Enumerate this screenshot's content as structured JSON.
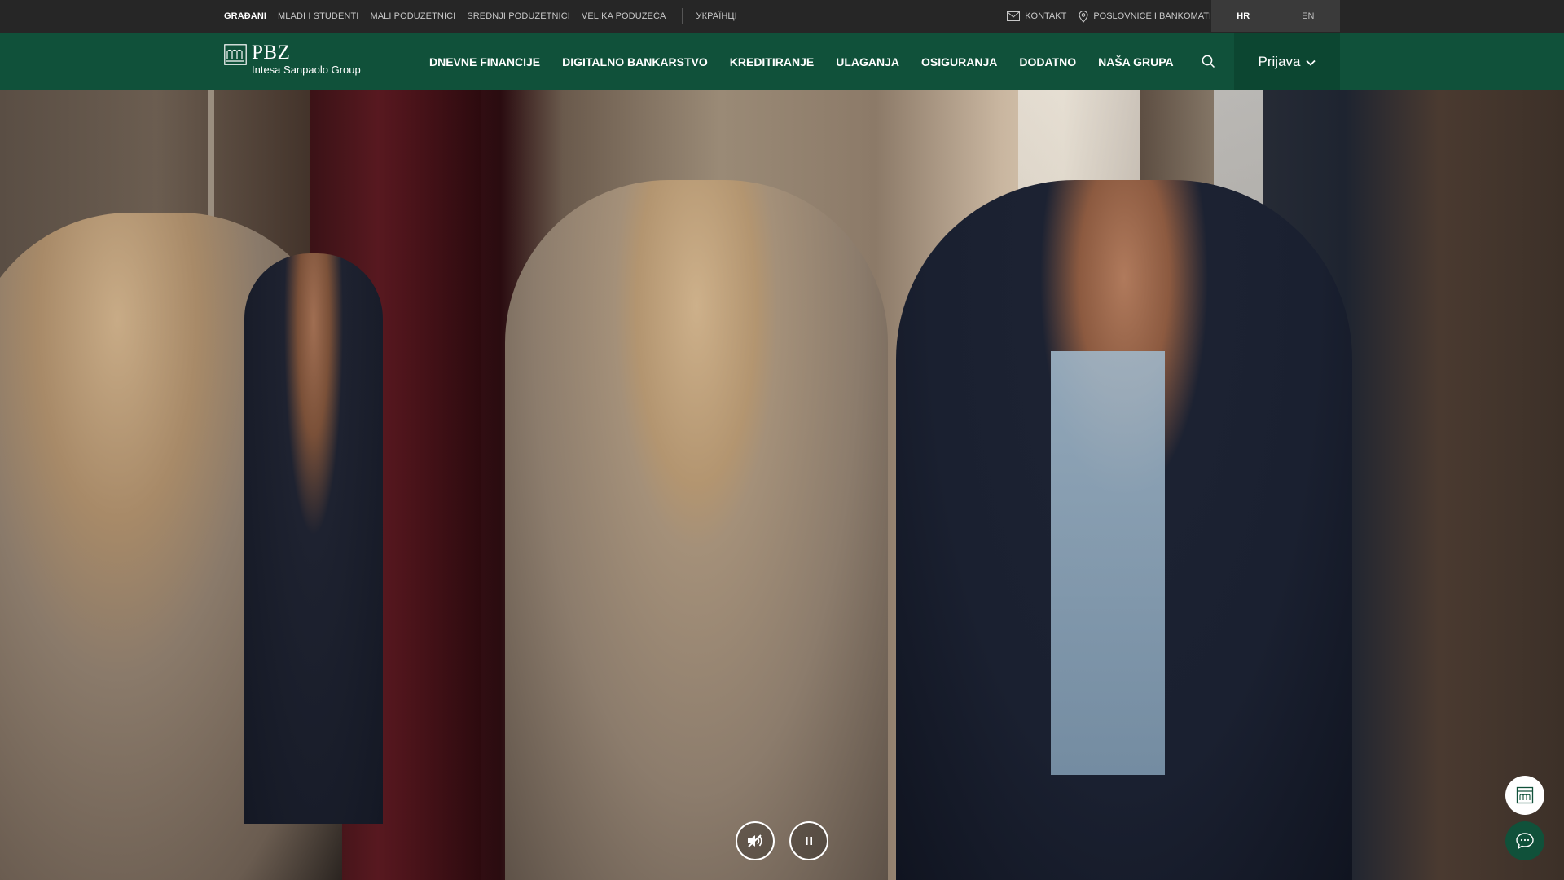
{
  "topbar": {
    "segments": [
      {
        "label": "GRAĐANI",
        "active": true
      },
      {
        "label": "MLADI I STUDENTI",
        "active": false
      },
      {
        "label": "MALI PODUZETNICI",
        "active": false
      },
      {
        "label": "SREDNJI PODUZETNICI",
        "active": false
      },
      {
        "label": "VELIKA PODUZEĆA",
        "active": false
      }
    ],
    "ukrainian_label": "УКРАЇНЦІ",
    "contact_label": "KONTAKT",
    "branches_label": "POSLOVNICE I BANKOMATI",
    "languages": [
      {
        "label": "HR",
        "active": true
      },
      {
        "label": "EN",
        "active": false
      }
    ]
  },
  "nav": {
    "logo_name": "PBZ",
    "logo_group": "Intesa Sanpaolo Group",
    "menu": [
      "DNEVNE FINANCIJE",
      "DIGITALNO BANKARSTVO",
      "KREDITIRANJE",
      "ULAGANJA",
      "OSIGURANJA",
      "DODATNO",
      "NAŠA GRUPA"
    ],
    "login_label": "Prijava"
  },
  "video": {
    "muted": true,
    "playing": true
  },
  "icons": {
    "contact": "envelope-icon",
    "branches": "location-pin-icon",
    "search": "search-icon",
    "login_chevron": "chevron-down-icon",
    "mute": "speaker-muted-icon",
    "pause": "pause-icon",
    "calculator": "calculator-icon",
    "chat": "chat-bubble-icon"
  },
  "colors": {
    "brand_green": "#10513a",
    "topbar": "#262626",
    "lang_box": "#3a3a3a"
  }
}
